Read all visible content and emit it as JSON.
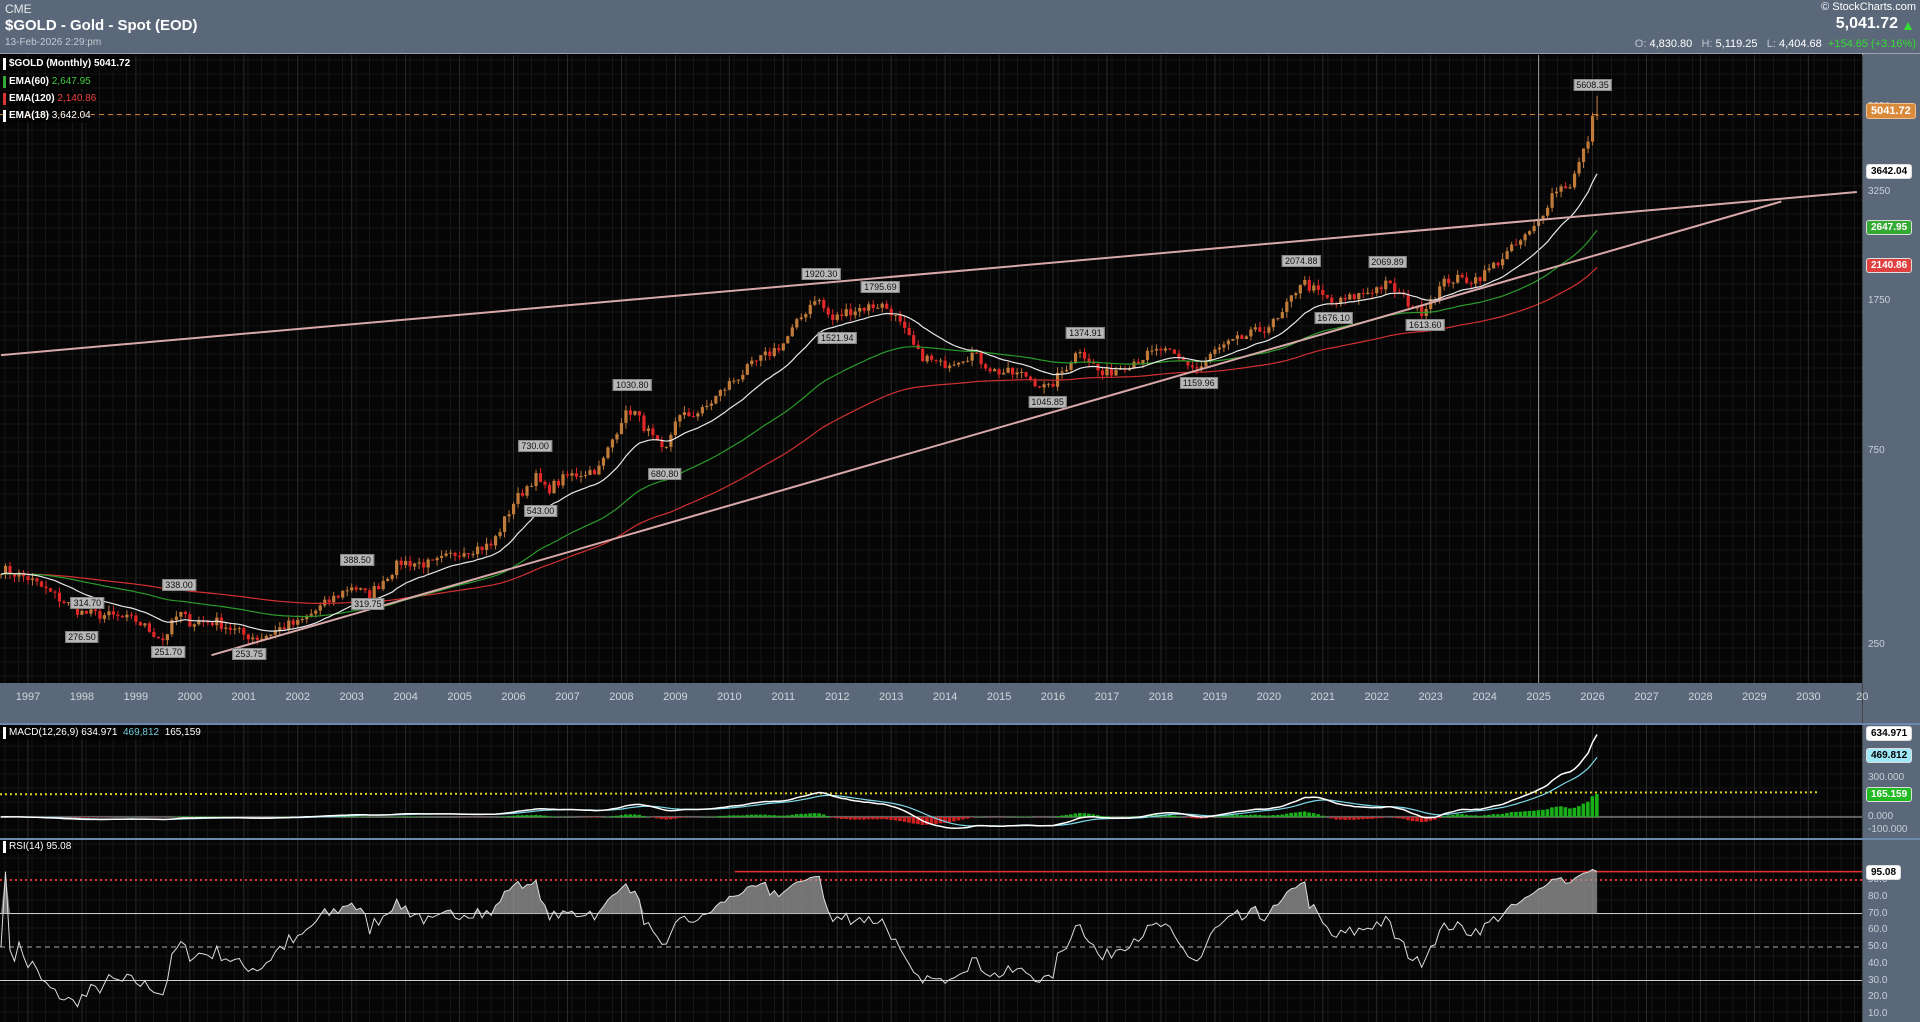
{
  "header": {
    "exchange": "CME",
    "title": "$GOLD - Gold - Spot (EOD)",
    "timestamp": "13-Feb-2026 2:29:pm",
    "brand": "© StockCharts.com",
    "last": "5,041.72",
    "open_label": "O:",
    "open": "4,830.80",
    "high_label": "H:",
    "high": "5,119.25",
    "low_label": "L:",
    "low": "4,404.68",
    "change": "+154.65 (+3.16%)",
    "colors": {
      "up": "#33dd33"
    }
  },
  "legend": {
    "main": "$GOLD (Monthly) 5041.72",
    "ema60_label": "EMA(60)",
    "ema60": "2,647.95",
    "ema120_label": "EMA(120)",
    "ema120": "2,140.86",
    "ema18_label": "EMA(18)",
    "ema18": "3,642.04",
    "macd_label": "MACD(12,26,9) 634.971",
    "macd_signal": "469,812",
    "macd_hist": "165,159",
    "rsi_label": "RSI(14) 95.08"
  },
  "chart_data": {
    "type": "candlestick",
    "title": "$GOLD - Gold - Spot (EOD)",
    "interval": "monthly",
    "x_ticks": [
      "1997",
      "1998",
      "1999",
      "2000",
      "2001",
      "2002",
      "2003",
      "2004",
      "2005",
      "2006",
      "2007",
      "2008",
      "2009",
      "2010",
      "2011",
      "2012",
      "2013",
      "2014",
      "2015",
      "2016",
      "2017",
      "2018",
      "2019",
      "2020",
      "2021",
      "2022",
      "2023",
      "2024",
      "2025",
      "2026",
      "2027",
      "2028",
      "2029",
      "2030",
      "20"
    ],
    "y_scale": "log",
    "y_ticks": [
      "250",
      "750",
      "1750",
      "3250",
      "5250"
    ],
    "close_path": [
      [
        1996.5,
        385
      ],
      [
        1997.0,
        365
      ],
      [
        1997.5,
        330
      ],
      [
        1998.0,
        300
      ],
      [
        1998.5,
        295
      ],
      [
        1999.0,
        287
      ],
      [
        1999.5,
        258
      ],
      [
        1999.8,
        300
      ],
      [
        2000.0,
        285
      ],
      [
        2000.5,
        285
      ],
      [
        2001.0,
        265
      ],
      [
        2001.3,
        260
      ],
      [
        2001.8,
        280
      ],
      [
        2002.0,
        282
      ],
      [
        2002.5,
        315
      ],
      [
        2003.0,
        350
      ],
      [
        2003.3,
        330
      ],
      [
        2003.9,
        400
      ],
      [
        2004.5,
        395
      ],
      [
        2005.0,
        425
      ],
      [
        2005.6,
        440
      ],
      [
        2006.0,
        560
      ],
      [
        2006.4,
        650
      ],
      [
        2006.6,
        600
      ],
      [
        2007.0,
        650
      ],
      [
        2007.6,
        680
      ],
      [
        2008.0,
        900
      ],
      [
        2008.2,
        950
      ],
      [
        2008.8,
        730
      ],
      [
        2009.0,
        900
      ],
      [
        2009.5,
        940
      ],
      [
        2010.0,
        1100
      ],
      [
        2010.5,
        1240
      ],
      [
        2011.0,
        1380
      ],
      [
        2011.6,
        1800
      ],
      [
        2011.9,
        1570
      ],
      [
        2012.2,
        1660
      ],
      [
        2012.8,
        1720
      ],
      [
        2013.0,
        1660
      ],
      [
        2013.5,
        1300
      ],
      [
        2013.9,
        1220
      ],
      [
        2014.5,
        1300
      ],
      [
        2014.9,
        1180
      ],
      [
        2015.5,
        1150
      ],
      [
        2015.9,
        1060
      ],
      [
        2016.5,
        1340
      ],
      [
        2016.9,
        1150
      ],
      [
        2017.5,
        1250
      ],
      [
        2018.0,
        1330
      ],
      [
        2018.7,
        1190
      ],
      [
        2019.0,
        1320
      ],
      [
        2019.5,
        1420
      ],
      [
        2019.9,
        1500
      ],
      [
        2020.2,
        1580
      ],
      [
        2020.6,
        1970
      ],
      [
        2021.2,
        1720
      ],
      [
        2021.6,
        1800
      ],
      [
        2022.2,
        1930
      ],
      [
        2022.8,
        1640
      ],
      [
        2023.3,
        1980
      ],
      [
        2023.8,
        1980
      ],
      [
        2024.0,
        2050
      ],
      [
        2024.5,
        2350
      ],
      [
        2024.9,
        2620
      ],
      [
        2025.3,
        3300
      ],
      [
        2025.6,
        3400
      ],
      [
        2025.9,
        4300
      ],
      [
        2026.0,
        4887
      ],
      [
        2026.1,
        5041.72
      ]
    ],
    "last_high": 5608.35,
    "annotations": [
      [
        "314.70",
        1998.1,
        318
      ],
      [
        "276.50",
        1998.0,
        262
      ],
      [
        "251.70",
        1999.6,
        240
      ],
      [
        "338.00",
        1999.8,
        352
      ],
      [
        "253.75",
        2001.1,
        238
      ],
      [
        "388.50",
        2003.1,
        405
      ],
      [
        "319.75",
        2003.3,
        315
      ],
      [
        "730.00",
        2006.4,
        770
      ],
      [
        "543.00",
        2006.5,
        535
      ],
      [
        "1030.80",
        2008.2,
        1090
      ],
      [
        "680.80",
        2008.8,
        660
      ],
      [
        "1920.30",
        2011.7,
        2040
      ],
      [
        "1795.69",
        2012.8,
        1900
      ],
      [
        "1521.94",
        2012.0,
        1420
      ],
      [
        "1374.91",
        2016.6,
        1460
      ],
      [
        "1045.85",
        2015.9,
        990
      ],
      [
        "1159.96",
        2018.7,
        1100
      ],
      [
        "2074.88",
        2020.6,
        2200
      ],
      [
        "1676.10",
        2021.2,
        1590
      ],
      [
        "2069.89",
        2022.2,
        2190
      ],
      [
        "1613.60",
        2022.9,
        1530
      ],
      [
        "5608.35",
        2026.0,
        5950
      ]
    ],
    "trendlines": [
      {
        "from": [
          1996.5,
          1291
        ],
        "to": [
          2030.9,
          3250
        ]
      },
      {
        "from": [
          2000.4,
          236
        ],
        "to": [
          2029.5,
          3080
        ]
      }
    ],
    "ema_periods": [
      18,
      60,
      120
    ],
    "macd": {
      "params": [
        12,
        26,
        9
      ],
      "value": 634.971,
      "signal": 469.812,
      "hist": 165.159,
      "ticks": [
        "300.000",
        "0.000",
        "-100.000"
      ],
      "ylim": [
        -130,
        700
      ],
      "ref_level": 185
    },
    "rsi": {
      "period": 14,
      "value": 95.08,
      "ticks": [
        "90.0",
        "80.0",
        "70.0",
        "60.0",
        "50.0",
        "40.0",
        "30.0",
        "20.0",
        "10.0"
      ],
      "levels": [
        70,
        50,
        30
      ],
      "alert_level": 90
    },
    "vertical_marker": 2025.0
  },
  "tags": {
    "price": "5041.72",
    "ema18": "3642.04",
    "ema60": "2647.95",
    "ema120": "2140.86",
    "macd": "634.971",
    "signal": "469.812",
    "hist": "165.159",
    "rsi": "95.08"
  }
}
